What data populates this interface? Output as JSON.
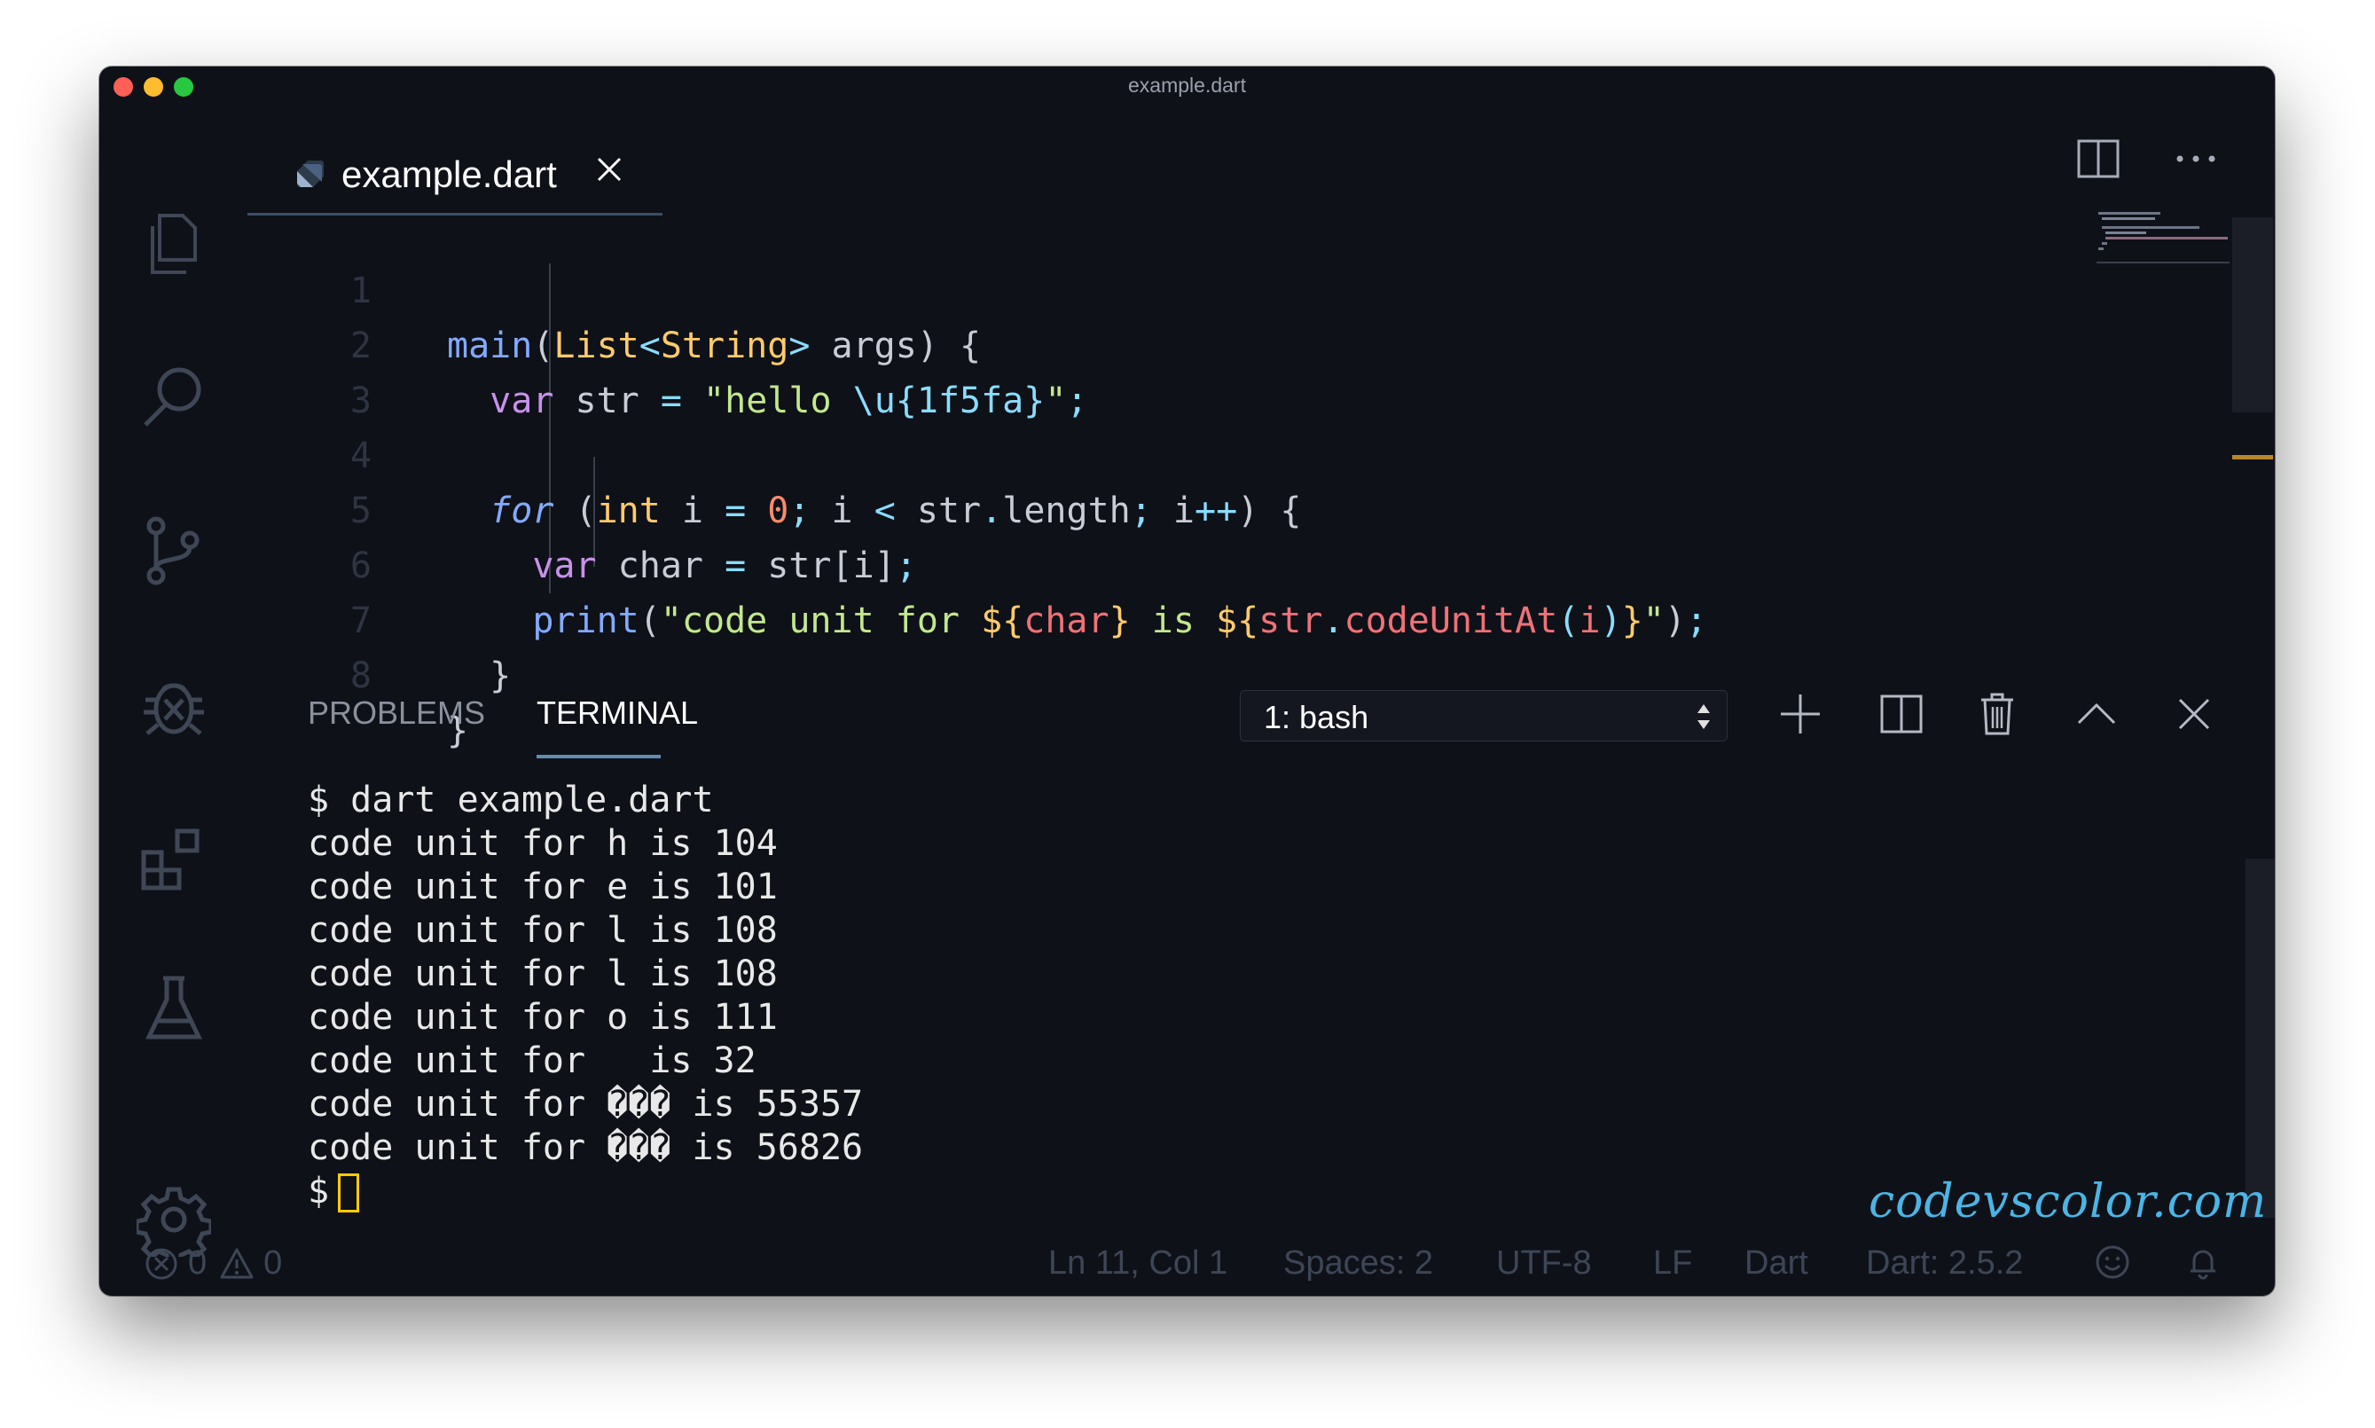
{
  "window": {
    "title": "example.dart"
  },
  "activity_bar": {
    "items": [
      "files-icon",
      "search-icon",
      "source-control-icon",
      "debug-icon",
      "extensions-icon",
      "testing-icon",
      "settings-gear-icon"
    ]
  },
  "tab": {
    "label": "example.dart",
    "icon": "dart-file-icon"
  },
  "editor": {
    "line_numbers": [
      "1",
      "2",
      "3",
      "4",
      "5",
      "6",
      "7",
      "8"
    ],
    "code_lines": [
      "main(List<String> args) {",
      "  var str = \"hello \\u{1f5fa}\";",
      "",
      "  for (int i = 0; i < str.length; i++) {",
      "    var char = str[i];",
      "    print(\"code unit for ${char} is ${str.codeUnitAt(i)}\");",
      "  }",
      "}"
    ]
  },
  "panel": {
    "tabs": [
      "PROBLEMS",
      "TERMINAL"
    ],
    "active_tab": "TERMINAL",
    "terminal_select": "1: bash",
    "terminal_lines": [
      "$ dart example.dart",
      "code unit for h is 104",
      "code unit for e is 101",
      "code unit for l is 108",
      "code unit for l is 108",
      "code unit for o is 111",
      "code unit for   is 32",
      "code unit for ��� is 55357",
      "code unit for ��� is 56826"
    ],
    "prompt": "$"
  },
  "watermark": "codevscolor.com",
  "status_bar": {
    "errors": "0",
    "warnings": "0",
    "position": "Ln 11, Col 1",
    "spaces": "Spaces: 2",
    "encoding": "UTF-8",
    "eol": "LF",
    "language": "Dart",
    "sdk": "Dart: 2.5.2"
  },
  "colors": {
    "background": "#0f1118",
    "keyword": "#c792ea",
    "function": "#82aaff",
    "type": "#ffcb6b",
    "string": "#c3e88d",
    "number": "#f78c6c",
    "variable": "#f07178",
    "accent": "#5e8db3",
    "cursor": "#ffcc00"
  }
}
